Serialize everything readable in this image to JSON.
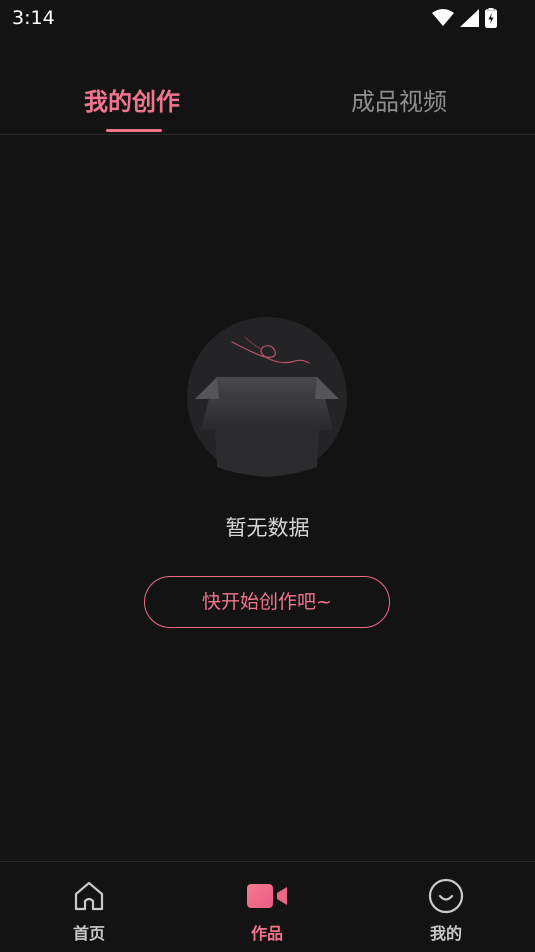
{
  "status_bar": {
    "time": "3:14",
    "icons": [
      "wifi-icon",
      "signal-icon",
      "battery-charging-icon"
    ]
  },
  "tabs": [
    {
      "label": "我的创作",
      "active": true
    },
    {
      "label": "成品视频",
      "active": false
    }
  ],
  "empty_state": {
    "illustration": "empty-box-icon",
    "message": "暂无数据",
    "action_label": "快开始创作吧~"
  },
  "bottom_nav": [
    {
      "label": "首页",
      "icon": "home-icon",
      "active": false
    },
    {
      "label": "作品",
      "icon": "video-camera-icon",
      "active": true
    },
    {
      "label": "我的",
      "icon": "smiley-face-icon",
      "active": false
    }
  ],
  "colors": {
    "background": "#141314",
    "accent": "#f2748f",
    "inactive_text": "#8e8d90",
    "divider": "#2b2a2c"
  }
}
